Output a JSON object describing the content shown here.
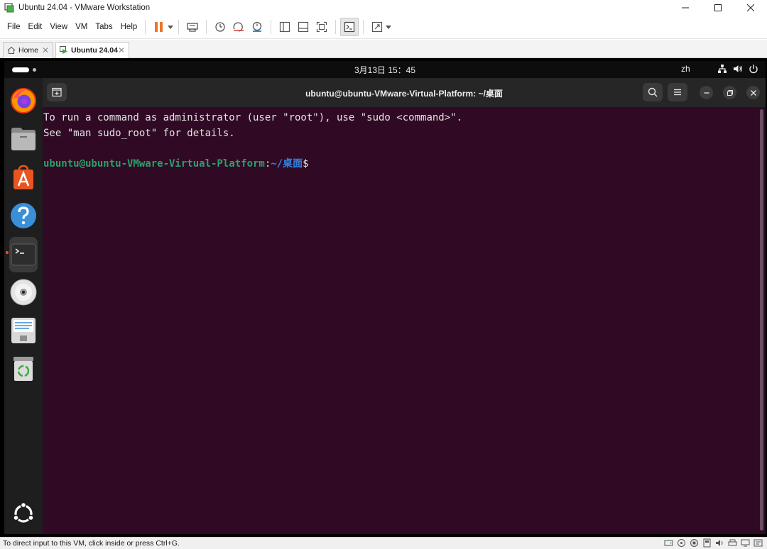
{
  "window": {
    "title": "Ubuntu 24.04 - VMware Workstation"
  },
  "menu": {
    "items": [
      "File",
      "Edit",
      "View",
      "VM",
      "Tabs",
      "Help"
    ]
  },
  "tabs": [
    {
      "label": "Home"
    },
    {
      "label": "Ubuntu 24.04"
    }
  ],
  "gnome": {
    "clock": "3月13日  15：45",
    "ime": "zh"
  },
  "dock": {
    "items": [
      "firefox-icon",
      "files-icon",
      "app-center-icon",
      "help-icon",
      "terminal-icon",
      "disc-icon",
      "text-editor-icon",
      "trash-icon"
    ],
    "active": "terminal-icon"
  },
  "terminal": {
    "title": "ubuntu@ubuntu-VMware-Virtual-Platform: ~/桌面",
    "lines": [
      "To run a command as administrator (user \"root\"), use \"sudo <command>\".",
      "See \"man sudo_root\" for details."
    ],
    "prompt": {
      "user": "ubuntu@ubuntu-VMware-Virtual-Platform",
      "sep": ":",
      "path": "~/桌面",
      "symbol": "$"
    }
  },
  "statusbar": {
    "text": "To direct input to this VM, click inside or press Ctrl+G."
  },
  "colors": {
    "terminal_bg": "#300a24",
    "prompt_user": "#26a269",
    "prompt_path": "#3584e4",
    "accent_pause": "#e8762d",
    "ubuntu_orange": "#e95420"
  }
}
